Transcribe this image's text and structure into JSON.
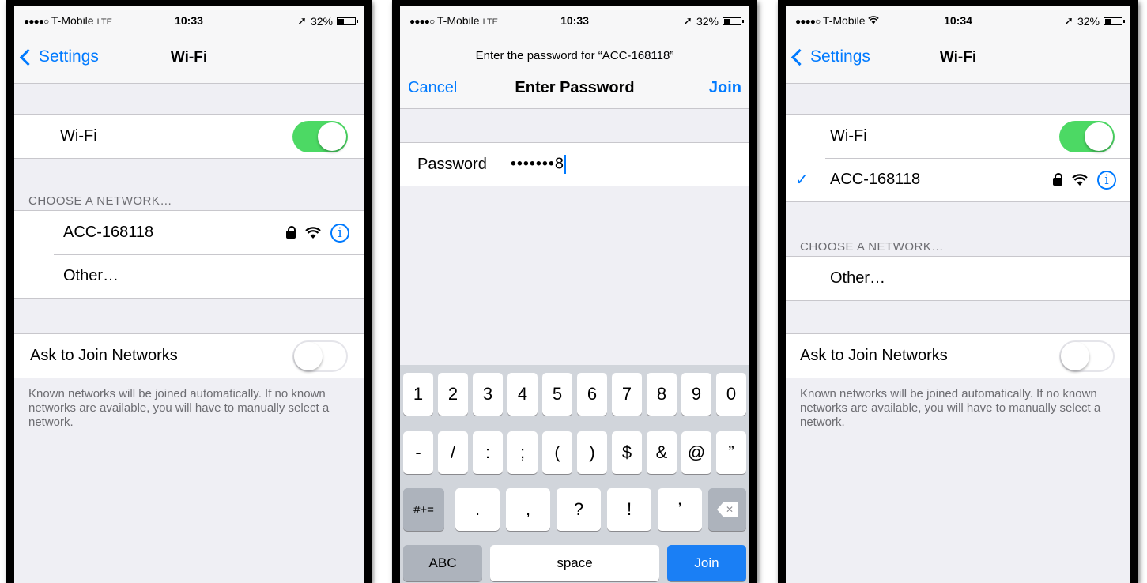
{
  "status_bar": [
    {
      "carrier": "T-Mobile",
      "network": "LTE",
      "time": "10:33",
      "battery": "32%",
      "battery_level": 0.32
    },
    {
      "carrier": "T-Mobile",
      "network": "LTE",
      "time": "10:33",
      "battery": "32%",
      "battery_level": 0.32
    },
    {
      "carrier": "T-Mobile",
      "network": "",
      "time": "10:34",
      "battery": "32%",
      "battery_level": 0.32
    }
  ],
  "screen1": {
    "back_label": "Settings",
    "title": "Wi-Fi",
    "wifi_label": "Wi-Fi",
    "wifi_on": true,
    "choose_header": "CHOOSE A NETWORK…",
    "networks": [
      {
        "name": "ACC-168118",
        "locked": true
      },
      {
        "name": "Other…"
      }
    ],
    "ask_label": "Ask to Join Networks",
    "ask_on": false,
    "footer": "Known networks will be joined automatically. If no known networks are available, you will have to manually select a network."
  },
  "screen2": {
    "prompt": "Enter the password for “ACC-168118”",
    "cancel_label": "Cancel",
    "title": "Enter Password",
    "join_label": "Join",
    "password_label": "Password",
    "password_value": "•••••••8",
    "keyboard": {
      "row1": [
        "1",
        "2",
        "3",
        "4",
        "5",
        "6",
        "7",
        "8",
        "9",
        "0"
      ],
      "row2": [
        "-",
        "/",
        ":",
        ";",
        "(",
        ")",
        "$",
        "&",
        "@",
        "”"
      ],
      "row3_left": "#+=",
      "row3": [
        ".",
        ",",
        "?",
        "!",
        "’"
      ],
      "abc_label": "ABC",
      "space_label": "space",
      "join_label": "Join"
    }
  },
  "screen3": {
    "back_label": "Settings",
    "title": "Wi-Fi",
    "wifi_label": "Wi-Fi",
    "wifi_on": true,
    "connected_network": "ACC-168118",
    "choose_header": "CHOOSE A NETWORK…",
    "other_label": "Other…",
    "ask_label": "Ask to Join Networks",
    "ask_on": false,
    "footer": "Known networks will be joined automatically. If no known networks are available, you will have to manually select a network."
  },
  "icons": [
    "chevron-left-icon",
    "lock-icon",
    "wifi-icon",
    "info-icon",
    "checkmark-icon",
    "battery-icon",
    "location-arrow-icon",
    "delete-key-icon",
    "signal-dots-icon"
  ],
  "colors": {
    "accent": "#007aff",
    "toggle_on": "#4cd964",
    "background": "#efeff4"
  }
}
